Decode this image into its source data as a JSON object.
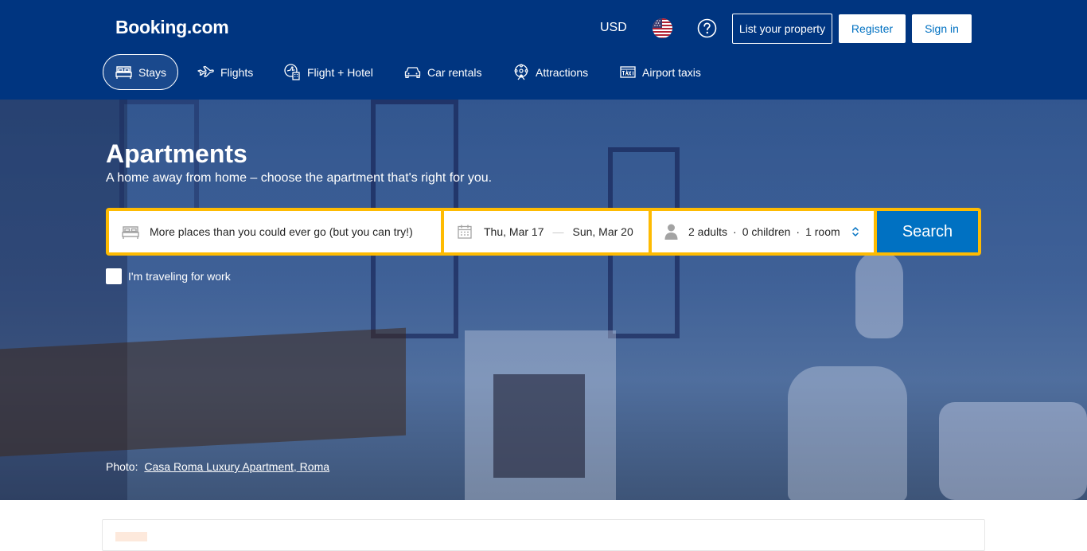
{
  "header": {
    "logo": "Booking.com",
    "currency": "USD",
    "flag_icon": "us-flag-icon",
    "help_icon": "help-icon",
    "list_property_label": "List your property",
    "register_label": "Register",
    "signin_label": "Sign in",
    "colors": {
      "background": "#003580",
      "accent": "#0071c2"
    }
  },
  "nav": {
    "items": [
      {
        "label": "Stays",
        "icon": "bed-icon",
        "active": true
      },
      {
        "label": "Flights",
        "icon": "plane-icon",
        "active": false
      },
      {
        "label": "Flight + Hotel",
        "icon": "flight-hotel-icon",
        "active": false
      },
      {
        "label": "Car rentals",
        "icon": "car-icon",
        "active": false
      },
      {
        "label": "Attractions",
        "icon": "attractions-icon",
        "active": false
      },
      {
        "label": "Airport taxis",
        "icon": "taxi-icon",
        "active": false
      }
    ]
  },
  "hero": {
    "title": "Apartments",
    "subtitle": "A home away from home – choose the apartment that's right for you."
  },
  "search": {
    "destination_placeholder": "More places than you could ever go (but you can try!)",
    "checkin": "Thu, Mar 17",
    "date_separator": "—",
    "checkout": "Sun, Mar 20",
    "adults": "2 adults",
    "children": "0 children",
    "rooms": "1 room",
    "dot": "·",
    "button_label": "Search",
    "border_color": "#febb02"
  },
  "work_travel": {
    "label": "I'm traveling for work",
    "checked": false
  },
  "photo_credit": {
    "prefix": "Photo:",
    "link_text": "Casa Roma Luxury Apartment, Roma"
  }
}
